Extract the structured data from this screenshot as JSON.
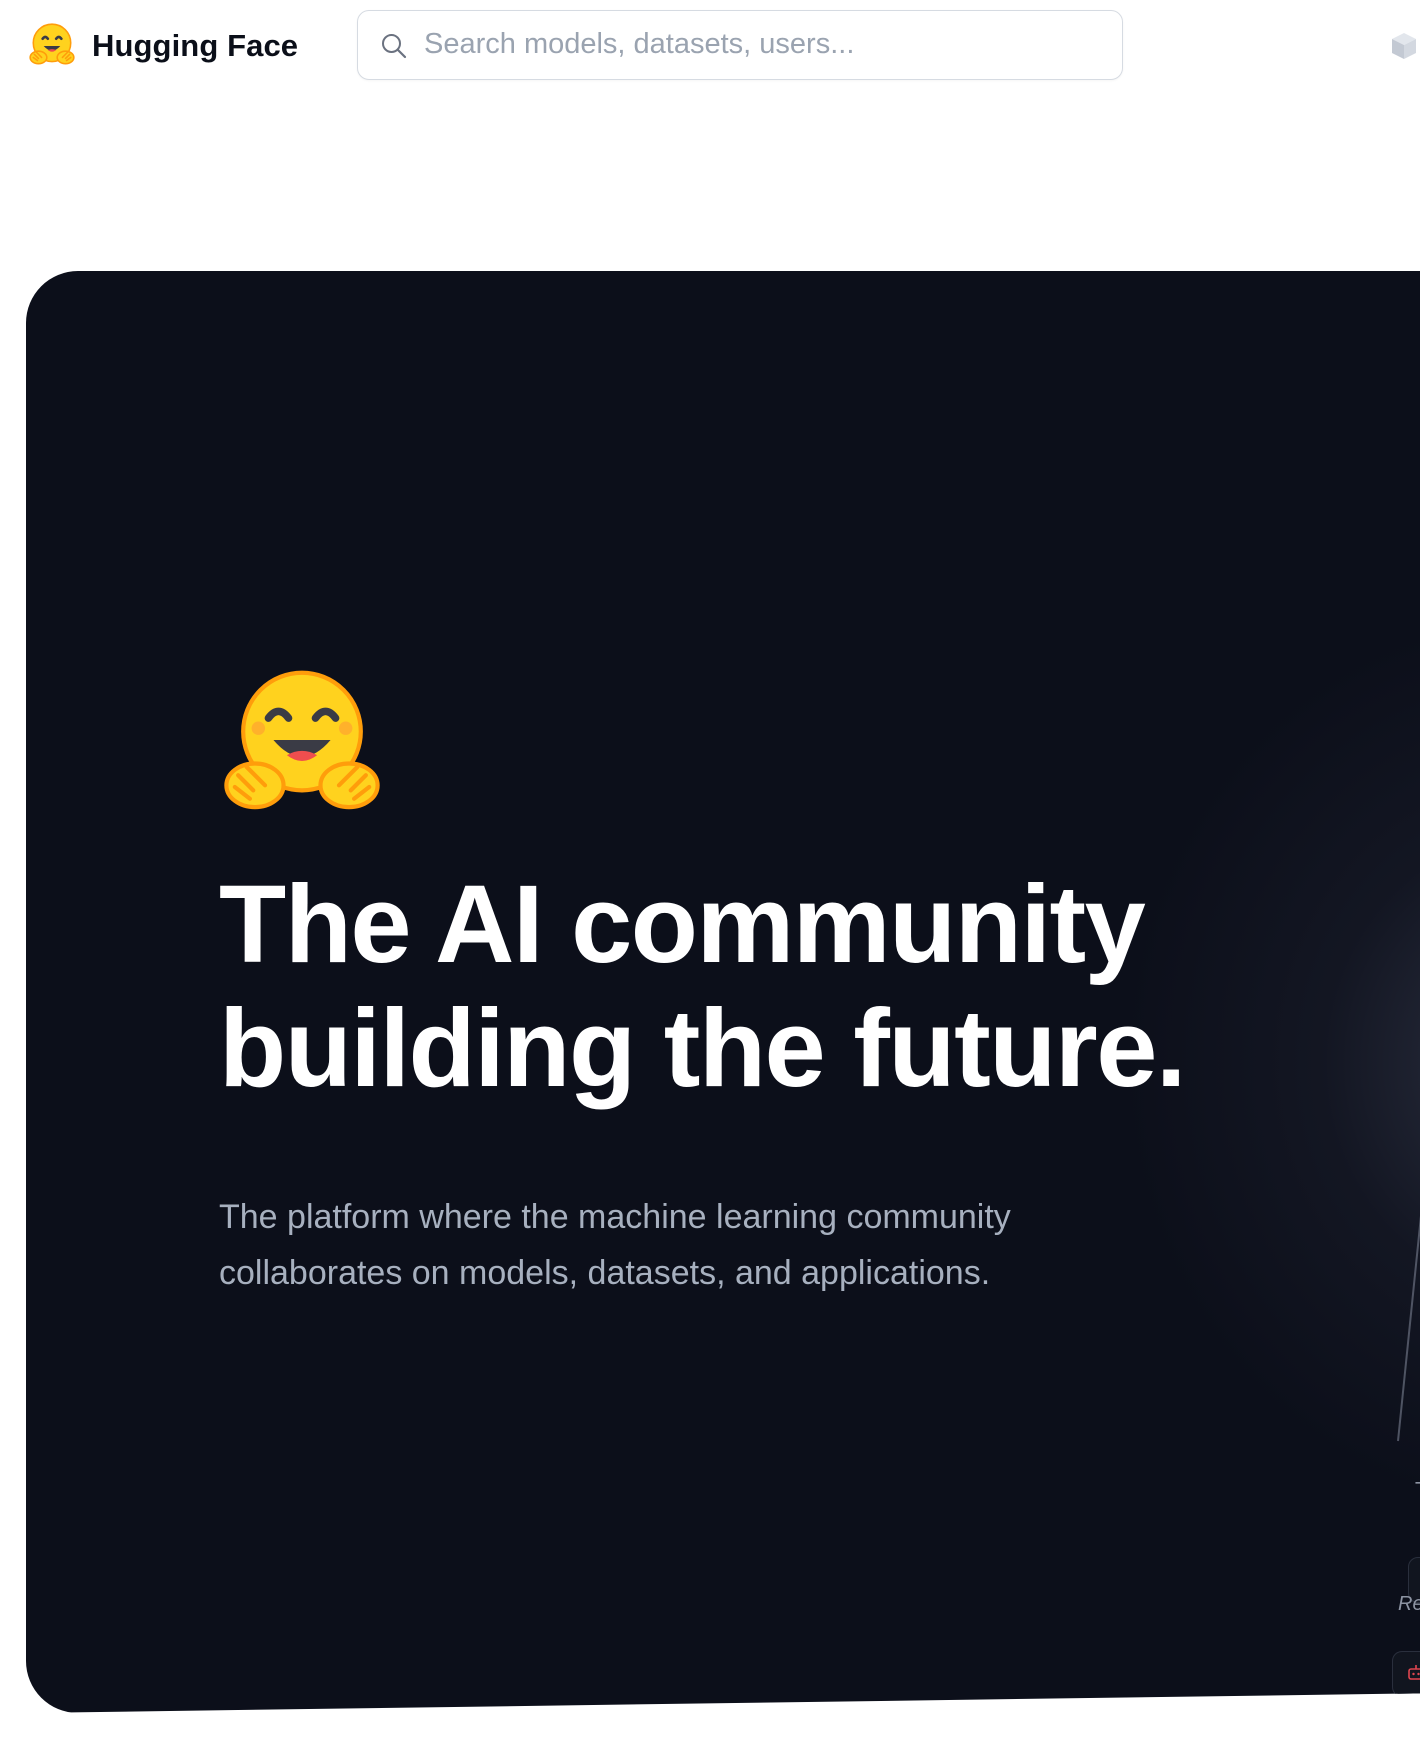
{
  "header": {
    "brand": "Hugging Face",
    "search": {
      "placeholder": "Search models, datasets, users...",
      "value": ""
    }
  },
  "hero": {
    "title_line1": "The AI community",
    "title_line2": "building the future.",
    "subtitle_line1": "The platform where the machine learning community",
    "subtitle_line2": "collaborates on models, datasets, and applications.",
    "peek_text_1": "T",
    "peek_text_2": "Re"
  },
  "colors": {
    "hero_background": "#0c0f1a",
    "brand_yellow": "#ffd21e",
    "brand_orange": "#ff9d0b",
    "subtitle": "#a7b0bf"
  },
  "icons": {
    "logo": "hugging-face-emoji-icon",
    "search": "search-icon",
    "models": "cube-icon",
    "hero": "hugging-face-emoji-icon"
  }
}
